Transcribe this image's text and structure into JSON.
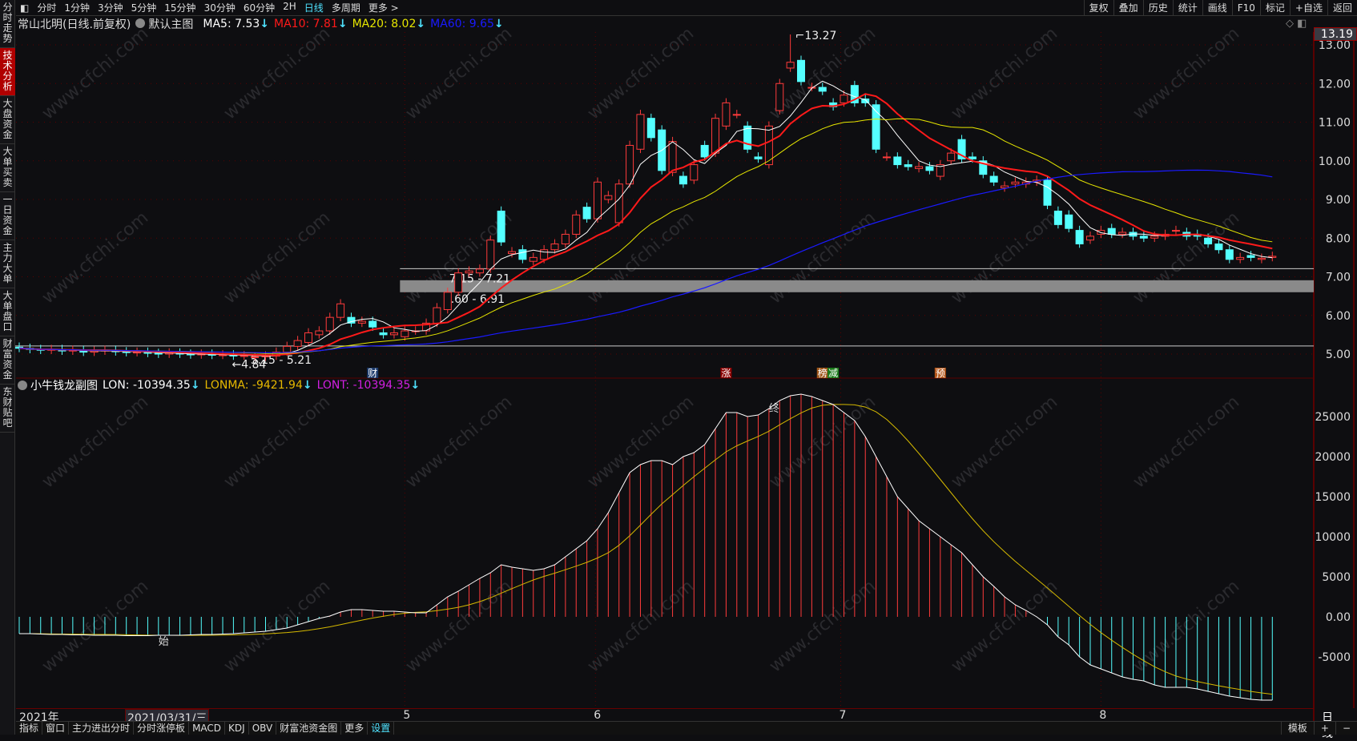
{
  "sidebar": [
    "分时走势",
    "技术分析",
    "大盘资金",
    "大单买卖",
    "一日资金",
    "主力大单",
    "大单盘口",
    "财富资金",
    "东财贴吧"
  ],
  "topbar": {
    "periods": [
      "分时",
      "1分钟",
      "3分钟",
      "5分钟",
      "15分钟",
      "30分钟",
      "60分钟",
      "2H",
      "日线",
      "多周期",
      "更多 >"
    ],
    "active": "日线",
    "right": [
      "复权",
      "叠加",
      "历史",
      "统计",
      "画线",
      "F10",
      "标记",
      "+自选",
      "返回"
    ]
  },
  "info": {
    "title": "常山北明(日线.前复权)",
    "template": "默认主图",
    "ma5": "MA5: 7.53",
    "ma10": "MA10: 7.81",
    "ma20": "MA20: 8.02",
    "ma60": "MA60: 9.65",
    "arrow": "↓"
  },
  "sub": {
    "title": "小牛钱龙副图",
    "lon": "LON: -10394.35",
    "lonma": "LONMA: -9421.94",
    "lont": "LONT: -10394.35"
  },
  "colors": {
    "up": "#ff3b3b",
    "down": "#54ffff",
    "ma5": "#ffffff",
    "ma10": "#ff1a1a",
    "ma20": "#e6e600",
    "ma60": "#1a1aff",
    "grid": "#5a0000",
    "bg": "#0e0e11"
  },
  "cursor_price": "13.19",
  "watermark": "www.cfchi.com",
  "tags": [
    {
      "text": "财",
      "index": 33,
      "color": "#1b3a6b"
    },
    {
      "text": "涨",
      "index": 66,
      "color": "#8b0000"
    },
    {
      "text": "榜",
      "index": 75,
      "color": "#a0561a"
    },
    {
      "text": "减",
      "index": 76,
      "color": "#1a7a1a"
    },
    {
      "text": "预",
      "index": 86,
      "color": "#b5561a"
    }
  ],
  "sub_marks": [
    {
      "text": "始",
      "index": 13
    },
    {
      "text": "终",
      "index": 70
    }
  ],
  "dates": {
    "year": "2021年",
    "cursor": "2021/03/31/三",
    "months": [
      {
        "label": "5",
        "index": 36
      },
      {
        "label": "6",
        "index": 53.8
      },
      {
        "label": "7",
        "index": 76.7
      },
      {
        "label": "8",
        "index": 101
      }
    ],
    "period": "日线"
  },
  "bottombar": {
    "items": [
      "指标",
      "窗口",
      "主力进出分时",
      "分时涨停板",
      "MACD",
      "KDJ",
      "OBV",
      "财富池资金图",
      "更多",
      "设置"
    ],
    "right": [
      "模板",
      "+",
      "−"
    ]
  },
  "chart_data": [
    {
      "type": "candlestick",
      "title": "常山北明(日线.前复权)",
      "yrange": [
        4.6,
        13.3
      ],
      "yticks": [
        13,
        12,
        11,
        10,
        9,
        8,
        7,
        6,
        5
      ],
      "candles": [
        [
          5.18,
          5.15
        ],
        [
          5.15,
          5.12
        ],
        [
          5.12,
          5.1
        ],
        [
          5.1,
          5.12
        ],
        [
          5.12,
          5.08
        ],
        [
          5.08,
          5.1
        ],
        [
          5.1,
          5.05
        ],
        [
          5.05,
          5.08
        ],
        [
          5.08,
          5.1
        ],
        [
          5.1,
          5.06
        ],
        [
          5.06,
          5.04
        ],
        [
          5.04,
          5.05
        ],
        [
          5.05,
          5.02
        ],
        [
          5.02,
          5.0
        ],
        [
          5.0,
          5.03
        ],
        [
          5.03,
          5.0
        ],
        [
          5.0,
          4.98
        ],
        [
          4.98,
          5.0
        ],
        [
          5.0,
          4.97
        ],
        [
          4.97,
          4.98
        ],
        [
          4.98,
          4.95
        ],
        [
          4.95,
          4.96
        ],
        [
          4.92,
          4.93
        ],
        [
          4.93,
          4.95
        ],
        [
          4.95,
          5.05
        ],
        [
          5.05,
          5.2
        ],
        [
          5.2,
          5.35
        ],
        [
          5.3,
          5.55
        ],
        [
          5.5,
          5.6
        ],
        [
          5.6,
          5.95
        ],
        [
          5.95,
          6.3
        ],
        [
          5.95,
          5.8
        ],
        [
          5.8,
          5.85
        ],
        [
          5.85,
          5.7
        ],
        [
          5.55,
          5.5
        ],
        [
          5.5,
          5.55
        ],
        [
          5.45,
          5.6
        ],
        [
          5.6,
          5.6
        ],
        [
          5.6,
          5.8
        ],
        [
          5.8,
          6.2
        ],
        [
          6.15,
          6.6
        ],
        [
          6.6,
          7.1
        ],
        [
          7.1,
          7.15
        ],
        [
          7.1,
          7.2
        ],
        [
          7.2,
          7.95
        ],
        [
          8.7,
          7.9
        ],
        [
          7.6,
          7.65
        ],
        [
          7.7,
          7.45
        ],
        [
          7.4,
          7.5
        ],
        [
          7.45,
          7.7
        ],
        [
          7.7,
          7.85
        ],
        [
          7.85,
          8.1
        ],
        [
          8.1,
          8.6
        ],
        [
          8.8,
          8.5
        ],
        [
          8.5,
          9.45
        ],
        [
          9.0,
          9.1
        ],
        [
          8.4,
          9.4
        ],
        [
          9.4,
          10.4
        ],
        [
          10.3,
          11.2
        ],
        [
          11.1,
          10.6
        ],
        [
          10.8,
          9.75
        ],
        [
          9.7,
          10.5
        ],
        [
          9.6,
          9.4
        ],
        [
          9.5,
          9.9
        ],
        [
          10.4,
          10.1
        ],
        [
          10.2,
          11.1
        ],
        [
          10.9,
          11.5
        ],
        [
          11.2,
          11.2
        ],
        [
          10.9,
          10.3
        ],
        [
          10.1,
          10.05
        ],
        [
          9.9,
          10.9
        ],
        [
          11.3,
          12.0
        ],
        [
          12.4,
          12.55
        ],
        [
          12.6,
          12.05
        ],
        [
          11.9,
          11.9
        ],
        [
          11.9,
          11.8
        ],
        [
          11.5,
          11.4
        ],
        [
          11.5,
          11.7
        ],
        [
          11.95,
          11.5
        ],
        [
          11.6,
          11.5
        ],
        [
          11.45,
          10.3
        ],
        [
          10.1,
          10.1
        ],
        [
          10.1,
          9.9
        ],
        [
          9.9,
          9.85
        ],
        [
          9.8,
          9.85
        ],
        [
          9.85,
          9.75
        ],
        [
          9.6,
          9.9
        ],
        [
          10.0,
          10.2
        ],
        [
          10.55,
          10.05
        ],
        [
          10.1,
          10.05
        ],
        [
          10.0,
          9.65
        ],
        [
          9.6,
          9.45
        ],
        [
          9.3,
          9.35
        ],
        [
          9.4,
          9.45
        ],
        [
          9.4,
          9.45
        ],
        [
          9.45,
          9.5
        ],
        [
          9.5,
          8.85
        ],
        [
          8.7,
          8.35
        ],
        [
          8.6,
          8.25
        ],
        [
          8.2,
          7.85
        ],
        [
          7.95,
          8.05
        ],
        [
          8.1,
          8.2
        ],
        [
          8.25,
          8.1
        ],
        [
          8.1,
          8.15
        ],
        [
          8.15,
          8.05
        ],
        [
          8.05,
          8.0
        ],
        [
          8.0,
          8.05
        ],
        [
          8.05,
          8.1
        ],
        [
          8.2,
          8.2
        ],
        [
          8.15,
          8.05
        ],
        [
          8.1,
          8.05
        ],
        [
          8.0,
          7.85
        ],
        [
          7.85,
          7.7
        ],
        [
          7.7,
          7.45
        ],
        [
          7.45,
          7.5
        ],
        [
          7.55,
          7.5
        ],
        [
          7.45,
          7.48
        ],
        [
          7.5,
          7.53
        ]
      ],
      "ma_periods": [
        5,
        10,
        20,
        60
      ],
      "high_label": {
        "index": 72,
        "value": 13.27,
        "text": "13.27"
      },
      "low_label": {
        "index": 20,
        "value": 4.84,
        "text": "4.84"
      },
      "zones": [
        {
          "text": "7.15 - 7.21",
          "low": 7.15,
          "high": 7.21,
          "from": 36,
          "kind": "line"
        },
        {
          "text": "6.60 - 6.91",
          "low": 6.6,
          "high": 6.91,
          "from": 36,
          "kind": "band"
        },
        {
          "text": "5.15 - 5.21",
          "low": 5.15,
          "high": 5.21,
          "from": 0,
          "kind": "line"
        }
      ]
    },
    {
      "type": "line",
      "title": "小牛钱龙副图",
      "yrange": [
        -8000,
        29000
      ],
      "yticks": [
        {
          "v": 25000,
          "t": "25000"
        },
        {
          "v": 20000,
          "t": "20000"
        },
        {
          "v": 15000,
          "t": "15000"
        },
        {
          "v": 10000,
          "t": "10000"
        },
        {
          "v": 5000,
          "t": "5000"
        },
        {
          "v": 0,
          "t": "0.00"
        },
        {
          "v": -5000,
          "t": "-5000"
        }
      ],
      "lon": [
        -2100,
        -2100,
        -2150,
        -2200,
        -2200,
        -2250,
        -2250,
        -2300,
        -2300,
        -2300,
        -2350,
        -2350,
        -2350,
        -2300,
        -2300,
        -2300,
        -2250,
        -2200,
        -2200,
        -2150,
        -2100,
        -2000,
        -1900,
        -1800,
        -1600,
        -1400,
        -1000,
        -600,
        -200,
        100,
        600,
        900,
        900,
        800,
        700,
        700,
        600,
        500,
        500,
        1500,
        2500,
        3200,
        4000,
        4800,
        5500,
        6500,
        6200,
        6000,
        5800,
        6000,
        6500,
        7500,
        8500,
        9500,
        11000,
        13000,
        15500,
        18000,
        19000,
        19500,
        19500,
        19000,
        20000,
        20500,
        21500,
        23500,
        25500,
        25500,
        25000,
        25200,
        26000,
        27000,
        27600,
        27800,
        27500,
        27000,
        26500,
        25500,
        24500,
        22500,
        20000,
        17500,
        15000,
        13500,
        12000,
        11000,
        10000,
        9000,
        8000,
        6500,
        5000,
        3800,
        2500,
        1500,
        800,
        0,
        -1000,
        -2500,
        -3500,
        -5000,
        -6000,
        -6500,
        -7000,
        -7500,
        -7800,
        -8000,
        -8500,
        -8800,
        -8800,
        -8800,
        -9000,
        -9300,
        -9600,
        -9900,
        -10100,
        -10300,
        -10400,
        -10394.35
      ],
      "lonma_period": 10
    }
  ]
}
